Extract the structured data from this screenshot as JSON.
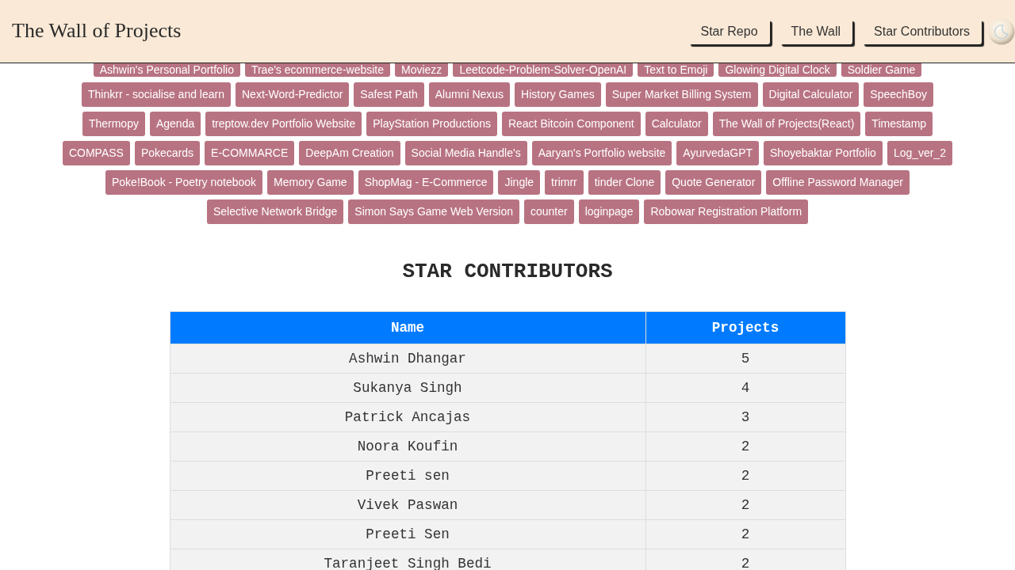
{
  "header": {
    "title": "The Wall of Projects",
    "nav": [
      "Star Repo",
      "The Wall",
      "Star Contributors"
    ]
  },
  "projects": {
    "items": [
      {
        "label": "Ashwin's Personal Portfolio",
        "partly_hidden": true
      },
      {
        "label": "Trae's ecommerce-website",
        "partly_hidden": true
      },
      {
        "label": "Moviezz",
        "partly_hidden": true
      },
      {
        "label": "Leetcode-Problem-Solver-OpenAI",
        "partly_hidden": true
      },
      {
        "label": "Text to Emoji",
        "partly_hidden": true
      },
      {
        "label": "Glowing Digital Clock",
        "partly_hidden": true
      },
      {
        "label": "Soldier Game",
        "partly_hidden": true
      },
      {
        "label": "Thinkrr - socialise and learn",
        "partly_hidden": false
      },
      {
        "label": "Next-Word-Predictor",
        "partly_hidden": false
      },
      {
        "label": "Safest Path",
        "partly_hidden": false
      },
      {
        "label": "Alumni Nexus",
        "partly_hidden": false
      },
      {
        "label": "History Games",
        "partly_hidden": false
      },
      {
        "label": "Super Market Billing System",
        "partly_hidden": false
      },
      {
        "label": "Digital Calculator",
        "partly_hidden": false
      },
      {
        "label": "SpeechBoy",
        "partly_hidden": false
      },
      {
        "label": "Thermopy",
        "partly_hidden": false
      },
      {
        "label": "Agenda",
        "partly_hidden": false
      },
      {
        "label": "treptow.dev Portfolio Website",
        "partly_hidden": false
      },
      {
        "label": "PlayStation Productions",
        "partly_hidden": false
      },
      {
        "label": "React Bitcoin Component",
        "partly_hidden": false
      },
      {
        "label": "Calculator",
        "partly_hidden": false
      },
      {
        "label": "The Wall of Projects(React)",
        "partly_hidden": false
      },
      {
        "label": "Timestamp",
        "partly_hidden": false
      },
      {
        "label": "COMPASS",
        "partly_hidden": false
      },
      {
        "label": "Pokecards",
        "partly_hidden": false
      },
      {
        "label": "E-COMMARCE",
        "partly_hidden": false
      },
      {
        "label": "DeepAm Creation",
        "partly_hidden": false
      },
      {
        "label": "Social Media Handle's",
        "partly_hidden": false
      },
      {
        "label": "Aaryan's Portfolio website",
        "partly_hidden": false
      },
      {
        "label": "AyurvedaGPT",
        "partly_hidden": false
      },
      {
        "label": "Shoyebaktar Portfolio",
        "partly_hidden": false
      },
      {
        "label": "Log_ver_2",
        "partly_hidden": false
      },
      {
        "label": "Poke!Book - Poetry notebook",
        "partly_hidden": false
      },
      {
        "label": "Memory Game",
        "partly_hidden": false
      },
      {
        "label": "ShopMag - E-Commerce",
        "partly_hidden": false
      },
      {
        "label": "Jingle",
        "partly_hidden": false
      },
      {
        "label": "trimrr",
        "partly_hidden": false
      },
      {
        "label": "tinder Clone",
        "partly_hidden": false
      },
      {
        "label": "Quote Generator",
        "partly_hidden": false
      },
      {
        "label": "Offline Password Manager",
        "partly_hidden": false
      },
      {
        "label": "Selective Network Bridge",
        "partly_hidden": false
      },
      {
        "label": "Simon Says Game Web Version",
        "partly_hidden": false
      },
      {
        "label": "counter",
        "partly_hidden": false
      },
      {
        "label": "loginpage",
        "partly_hidden": false
      },
      {
        "label": "Robowar Registration Platform",
        "partly_hidden": false
      }
    ]
  },
  "contributors": {
    "heading": "STAR CONTRIBUTORS",
    "columns": [
      "Name",
      "Projects"
    ],
    "rows": [
      [
        "Ashwin Dhangar",
        "5"
      ],
      [
        "Sukanya Singh",
        "4"
      ],
      [
        "Patrick Ancajas",
        "3"
      ],
      [
        "Noora Koufin",
        "2"
      ],
      [
        "Preeti sen",
        "2"
      ],
      [
        "Vivek Paswan",
        "2"
      ],
      [
        "Preeti Sen",
        "2"
      ],
      [
        "Taranjeet Singh Bedi",
        "2"
      ]
    ]
  }
}
